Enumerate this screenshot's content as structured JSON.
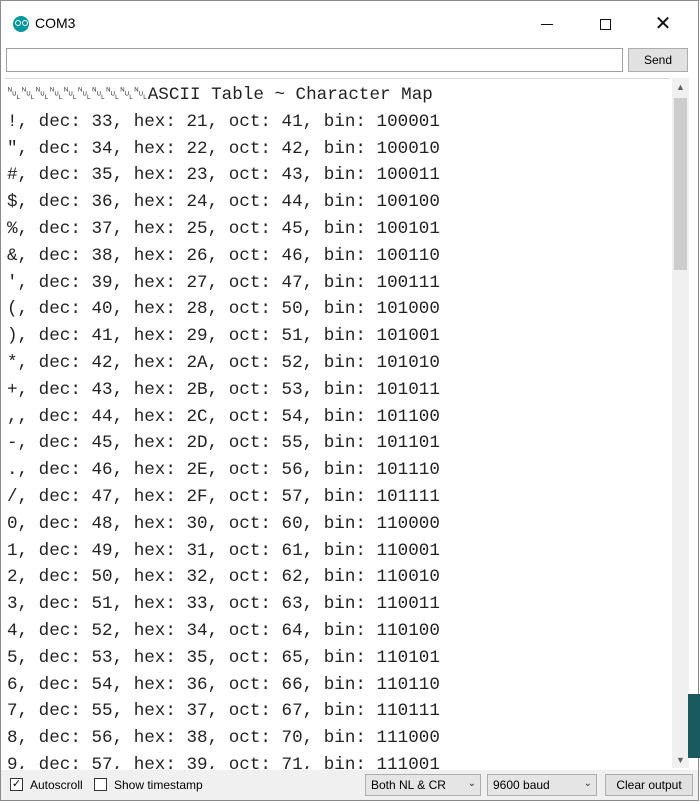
{
  "window": {
    "title": "COM3",
    "minimize_glyph": "",
    "maximize_glyph": "",
    "close_glyph": "✕"
  },
  "send_bar": {
    "input_value": "",
    "send_label": "Send"
  },
  "output_lines": [
    "␀␀␀␀␀␀␀␀␀␀ASCII Table ~ Character Map",
    "!, dec: 33, hex: 21, oct: 41, bin: 100001",
    "\", dec: 34, hex: 22, oct: 42, bin: 100010",
    "#, dec: 35, hex: 23, oct: 43, bin: 100011",
    "$, dec: 36, hex: 24, oct: 44, bin: 100100",
    "%, dec: 37, hex: 25, oct: 45, bin: 100101",
    "&, dec: 38, hex: 26, oct: 46, bin: 100110",
    "', dec: 39, hex: 27, oct: 47, bin: 100111",
    "(, dec: 40, hex: 28, oct: 50, bin: 101000",
    "), dec: 41, hex: 29, oct: 51, bin: 101001",
    "*, dec: 42, hex: 2A, oct: 52, bin: 101010",
    "+, dec: 43, hex: 2B, oct: 53, bin: 101011",
    ",, dec: 44, hex: 2C, oct: 54, bin: 101100",
    "-, dec: 45, hex: 2D, oct: 55, bin: 101101",
    "., dec: 46, hex: 2E, oct: 56, bin: 101110",
    "/, dec: 47, hex: 2F, oct: 57, bin: 101111",
    "0, dec: 48, hex: 30, oct: 60, bin: 110000",
    "1, dec: 49, hex: 31, oct: 61, bin: 110001",
    "2, dec: 50, hex: 32, oct: 62, bin: 110010",
    "3, dec: 51, hex: 33, oct: 63, bin: 110011",
    "4, dec: 52, hex: 34, oct: 64, bin: 110100",
    "5, dec: 53, hex: 35, oct: 65, bin: 110101",
    "6, dec: 54, hex: 36, oct: 66, bin: 110110",
    "7, dec: 55, hex: 37, oct: 67, bin: 110111",
    "8, dec: 56, hex: 38, oct: 70, bin: 111000",
    "9, dec: 57, hex: 39, oct: 71, bin: 111001"
  ],
  "status_bar": {
    "autoscroll_label": "Autoscroll",
    "autoscroll_checked": true,
    "timestamp_label": "Show timestamp",
    "timestamp_checked": false,
    "line_ending": "Both NL & CR",
    "baud_rate": "9600 baud",
    "clear_label": "Clear output"
  },
  "icons": {
    "app": "arduino-icon",
    "scroll_up": "chevron-up-icon",
    "scroll_down": "chevron-down-icon",
    "dropdown": "chevron-down-icon"
  },
  "colors": {
    "accent": "#00979c",
    "text": "#222222"
  }
}
